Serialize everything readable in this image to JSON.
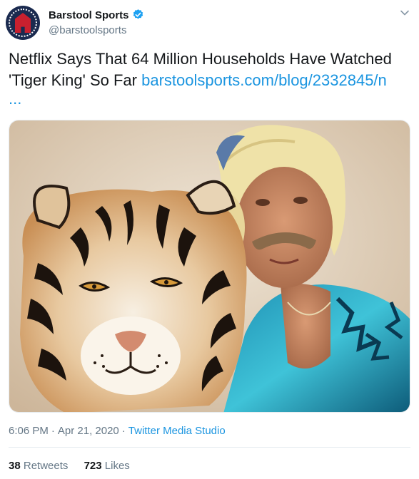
{
  "author": {
    "display_name": "Barstool Sports",
    "handle": "@barstoolsports",
    "verified": true,
    "avatar_icon": "barstool-logo-icon"
  },
  "tweet": {
    "text": "Netflix Says That 64 Million Households Have Watched 'Tiger King' So Far ",
    "link": "barstoolsports.com/blog/2332845/n",
    "link_ellipsis": "..."
  },
  "media": {
    "image_icon": "photo-icon"
  },
  "meta": {
    "time": "6:06 PM",
    "date": "Apr 21, 2020",
    "separator": "·",
    "source": "Twitter Media Studio"
  },
  "stats": {
    "retweets_count": "38",
    "retweets_label": "Retweets",
    "likes_count": "723",
    "likes_label": "Likes"
  },
  "colors": {
    "link": "#1b95e0",
    "secondary_text": "#657786",
    "primary_text": "#14171a",
    "verified": "#1da1f2"
  }
}
